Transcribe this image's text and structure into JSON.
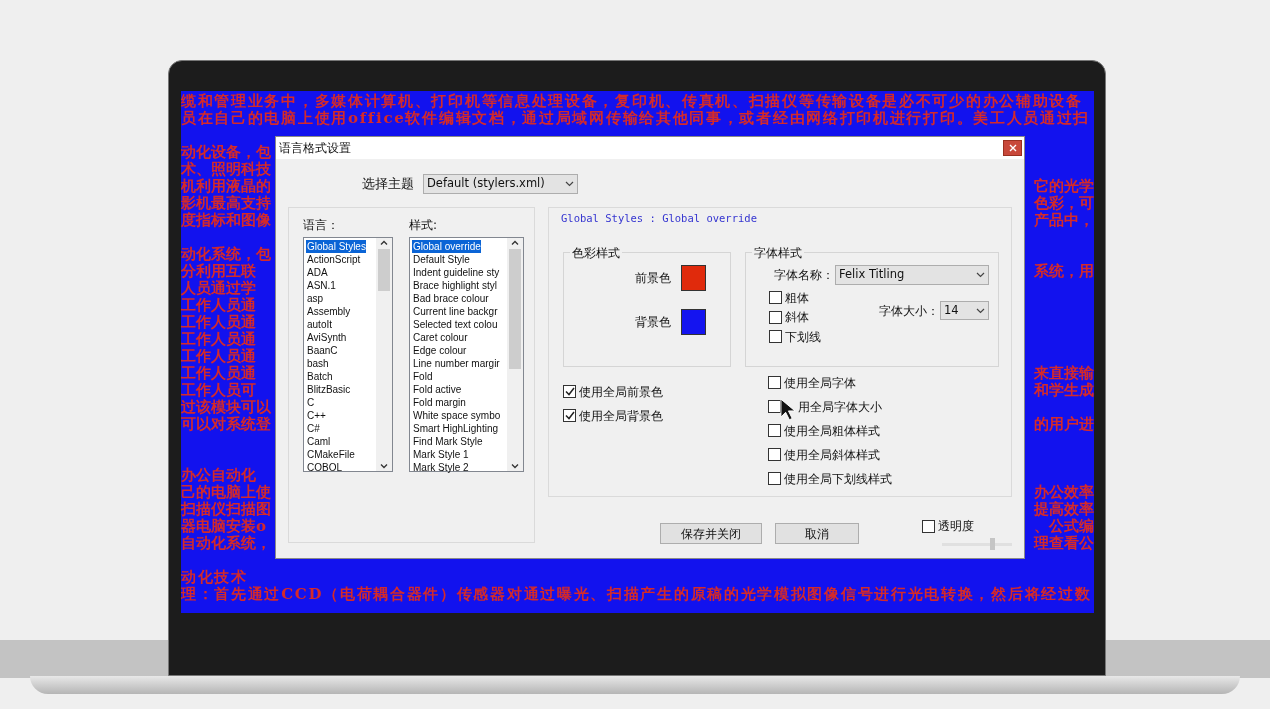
{
  "editor_lines": [
    {
      "kind": "full",
      "text": "缆和管理业务中，多媒体计算机、打印机等信息处理设备，复印机、传真机、扫描仪等传输设备是必不可少的办公辅助设备"
    },
    {
      "kind": "full",
      "text": "员在自己的电脑上使用office软件编辑文档，通过局域网传输给其他同事，或者经由网络打印机进行打印。美工人员通过扫"
    },
    {
      "kind": "blank"
    },
    {
      "kind": "split",
      "left": "动化设备，包"
    },
    {
      "kind": "split",
      "left": "术、照明科技"
    },
    {
      "kind": "split",
      "left": "机利用液晶的",
      "right": "它的光学"
    },
    {
      "kind": "split",
      "left": "影机最高支持",
      "right": "色彩，可"
    },
    {
      "kind": "split",
      "left": "度指标和图像",
      "right": "产品中，"
    },
    {
      "kind": "blank"
    },
    {
      "kind": "split",
      "left": "动化系统，包"
    },
    {
      "kind": "split",
      "left": "分利用互联",
      "right": "系统，用"
    },
    {
      "kind": "split",
      "left": "人员通过学"
    },
    {
      "kind": "split",
      "left": "工作人员通"
    },
    {
      "kind": "split",
      "left": "工作人员通"
    },
    {
      "kind": "split",
      "left": "工作人员通"
    },
    {
      "kind": "split",
      "left": "工作人员通"
    },
    {
      "kind": "split",
      "left": "工作人员通",
      "right": "来直接输"
    },
    {
      "kind": "split",
      "left": "工作人员可",
      "right": "和学生成"
    },
    {
      "kind": "split",
      "left": "过该模块可以"
    },
    {
      "kind": "split",
      "left": "可以对系统登",
      "right": "的用户进"
    },
    {
      "kind": "blank"
    },
    {
      "kind": "blank"
    },
    {
      "kind": "split",
      "left": "办公自动化"
    },
    {
      "kind": "split",
      "left": "己的电脑上使",
      "right": "办公效率"
    },
    {
      "kind": "split",
      "left": "扫描仪扫描图",
      "right": "提高效率"
    },
    {
      "kind": "split",
      "left": "器电脑安装o",
      "right": "、公式编"
    },
    {
      "kind": "split",
      "left": "自动化系统，",
      "right": "理查看公"
    },
    {
      "kind": "blank"
    },
    {
      "kind": "full",
      "text": "动化技术"
    },
    {
      "kind": "full",
      "text": "理：首先通过CCD（电荷耦合器件）传感器对通过曝光、扫描产生的原稿的光学模拟图像信号进行光电转换，然后将经过数"
    }
  ],
  "dialog": {
    "title": "语言格式设置",
    "theme": {
      "label": "选择主题",
      "value": "Default (stylers.xml)"
    },
    "language_list": {
      "label": "语言：",
      "items": [
        {
          "text": "Global Styles",
          "selected": true
        },
        {
          "text": "ActionScript",
          "selected": false
        },
        {
          "text": "ADA",
          "selected": false
        },
        {
          "text": "ASN.1",
          "selected": false
        },
        {
          "text": "asp",
          "selected": false
        },
        {
          "text": "Assembly",
          "selected": false
        },
        {
          "text": "autoIt",
          "selected": false
        },
        {
          "text": "AviSynth",
          "selected": false
        },
        {
          "text": "BaanC",
          "selected": false
        },
        {
          "text": "bash",
          "selected": false
        },
        {
          "text": "Batch",
          "selected": false
        },
        {
          "text": "BlitzBasic",
          "selected": false
        },
        {
          "text": "C",
          "selected": false
        },
        {
          "text": "C++",
          "selected": false
        },
        {
          "text": "C#",
          "selected": false
        },
        {
          "text": "Caml",
          "selected": false
        },
        {
          "text": "CMakeFile",
          "selected": false
        },
        {
          "text": "COBOL",
          "selected": false
        }
      ]
    },
    "style_list": {
      "label": "样式:",
      "items": [
        {
          "text": "Global override",
          "selected": true
        },
        {
          "text": "Default Style",
          "selected": false
        },
        {
          "text": "Indent guideline sty",
          "selected": false
        },
        {
          "text": "Brace highlight styl",
          "selected": false
        },
        {
          "text": "Bad brace colour",
          "selected": false
        },
        {
          "text": "Current line backgr",
          "selected": false
        },
        {
          "text": "Selected text colou",
          "selected": false
        },
        {
          "text": "Caret colour",
          "selected": false
        },
        {
          "text": "Edge colour",
          "selected": false
        },
        {
          "text": "Line number margir",
          "selected": false
        },
        {
          "text": "Fold",
          "selected": false
        },
        {
          "text": "Fold active",
          "selected": false
        },
        {
          "text": "Fold margin",
          "selected": false
        },
        {
          "text": "White space symbo",
          "selected": false
        },
        {
          "text": "Smart HighLighting",
          "selected": false
        },
        {
          "text": "Find Mark Style",
          "selected": false
        },
        {
          "text": "Mark Style 1",
          "selected": false
        },
        {
          "text": "Mark Style 2",
          "selected": false
        }
      ]
    },
    "style_header": "Global Styles : Global override",
    "colour_group": {
      "title": "色彩样式",
      "swatches": [
        {
          "label": "前景色",
          "color": "#e02a0c"
        },
        {
          "label": "背景色",
          "color": "#1414f0"
        }
      ]
    },
    "font_group": {
      "title": "字体样式",
      "name_label": "字体名称：",
      "name_value": "Felix Titling",
      "styles": [
        {
          "label": "粗体",
          "checked": false
        },
        {
          "label": "斜体",
          "checked": false
        },
        {
          "label": "下划线",
          "checked": false
        }
      ],
      "size_label": "字体大小：",
      "size_value": "14"
    },
    "global_colour_options": [
      {
        "label": "使用全局前景色",
        "checked": true
      },
      {
        "label": "使用全局背景色",
        "checked": true
      }
    ],
    "global_font_options": [
      {
        "label": "使用全局字体",
        "checked": false,
        "hovered": false
      },
      {
        "label": "用全局字体大小",
        "checked": false,
        "hovered": true
      },
      {
        "label": "使用全局粗体样式",
        "checked": false,
        "hovered": false
      },
      {
        "label": "使用全局斜体样式",
        "checked": false,
        "hovered": false
      },
      {
        "label": "使用全局下划线样式",
        "checked": false,
        "hovered": false
      }
    ],
    "buttons": [
      "保存并关闭",
      "取消"
    ],
    "transparency": {
      "label": "透明度",
      "checked": false,
      "level": 0.71
    }
  }
}
